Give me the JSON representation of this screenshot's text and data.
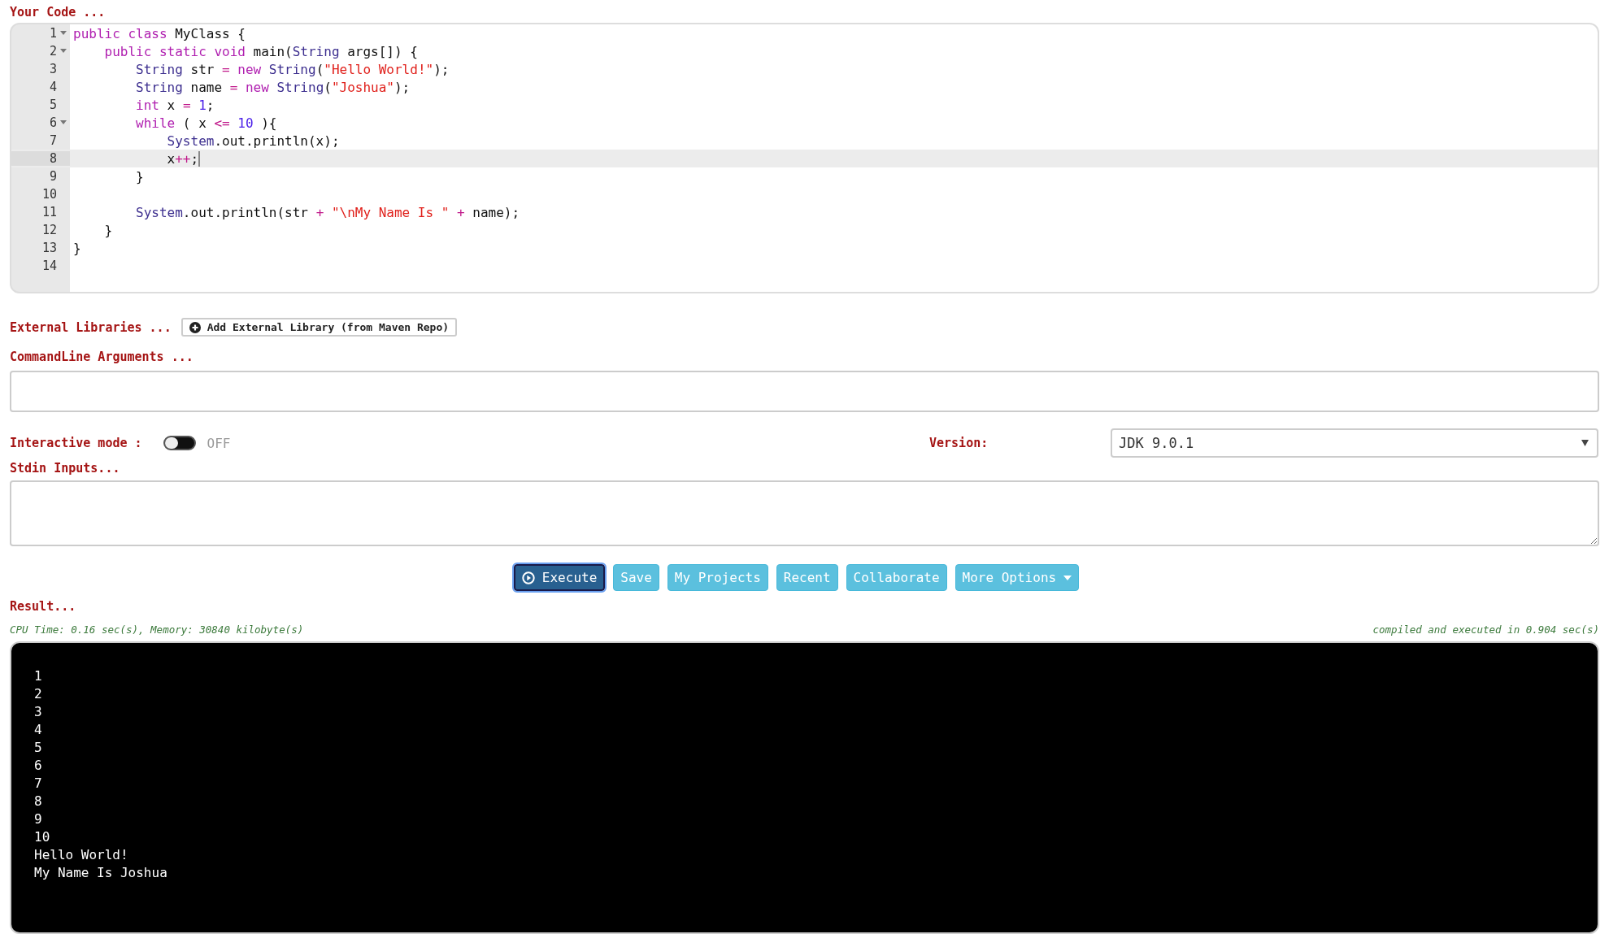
{
  "code_section": {
    "label": "Your Code ...",
    "lines": [
      {
        "number": "1",
        "foldable": true,
        "selected": false,
        "tokens": [
          {
            "kind": "keyword",
            "text": "public class"
          },
          {
            "kind": "plain",
            "text": " MyClass {"
          }
        ]
      },
      {
        "number": "2",
        "foldable": true,
        "selected": false,
        "tokens": [
          {
            "kind": "keyword",
            "text": "    public static void"
          },
          {
            "kind": "plain",
            "text": " main("
          },
          {
            "kind": "type",
            "text": "String"
          },
          {
            "kind": "plain",
            "text": " args[]) {"
          }
        ]
      },
      {
        "number": "3",
        "foldable": false,
        "selected": false,
        "tokens": [
          {
            "kind": "type",
            "text": "        String"
          },
          {
            "kind": "plain",
            "text": " str "
          },
          {
            "kind": "operator",
            "text": "="
          },
          {
            "kind": "keyword",
            "text": " new"
          },
          {
            "kind": "type",
            "text": " String"
          },
          {
            "kind": "plain",
            "text": "("
          },
          {
            "kind": "string",
            "text": "\"Hello World!\""
          },
          {
            "kind": "plain",
            "text": ");"
          }
        ]
      },
      {
        "number": "4",
        "foldable": false,
        "selected": false,
        "tokens": [
          {
            "kind": "type",
            "text": "        String"
          },
          {
            "kind": "plain",
            "text": " name "
          },
          {
            "kind": "operator",
            "text": "="
          },
          {
            "kind": "keyword",
            "text": " new"
          },
          {
            "kind": "type",
            "text": " String"
          },
          {
            "kind": "plain",
            "text": "("
          },
          {
            "kind": "string",
            "text": "\"Joshua\""
          },
          {
            "kind": "plain",
            "text": ");"
          }
        ]
      },
      {
        "number": "5",
        "foldable": false,
        "selected": false,
        "tokens": [
          {
            "kind": "keyword",
            "text": "        int"
          },
          {
            "kind": "plain",
            "text": " x "
          },
          {
            "kind": "operator",
            "text": "="
          },
          {
            "kind": "number",
            "text": " 1"
          },
          {
            "kind": "plain",
            "text": ";"
          }
        ]
      },
      {
        "number": "6",
        "foldable": true,
        "selected": false,
        "tokens": [
          {
            "kind": "keyword",
            "text": "        while"
          },
          {
            "kind": "plain",
            "text": " ( x "
          },
          {
            "kind": "operator",
            "text": "<="
          },
          {
            "kind": "number",
            "text": " 10"
          },
          {
            "kind": "plain",
            "text": " ){"
          }
        ]
      },
      {
        "number": "7",
        "foldable": false,
        "selected": false,
        "tokens": [
          {
            "kind": "type",
            "text": "            System"
          },
          {
            "kind": "plain",
            "text": ".out.println(x);"
          }
        ]
      },
      {
        "number": "8",
        "foldable": false,
        "selected": true,
        "tokens": [
          {
            "kind": "plain",
            "text": "            x"
          },
          {
            "kind": "operator",
            "text": "++"
          },
          {
            "kind": "plain",
            "text": ";"
          }
        ]
      },
      {
        "number": "9",
        "foldable": false,
        "selected": false,
        "tokens": [
          {
            "kind": "plain",
            "text": "        }"
          }
        ]
      },
      {
        "number": "10",
        "foldable": false,
        "selected": false
      },
      {
        "number": "11",
        "foldable": false,
        "selected": false,
        "tokens": [
          {
            "kind": "type",
            "text": "        System"
          },
          {
            "kind": "plain",
            "text": ".out.println(str "
          },
          {
            "kind": "operator",
            "text": "+"
          },
          {
            "kind": "string",
            "text": " \"\\nMy Name Is \""
          },
          {
            "kind": "operator",
            "text": " +"
          },
          {
            "kind": "plain",
            "text": " name);"
          }
        ]
      },
      {
        "number": "12",
        "foldable": false,
        "selected": false,
        "tokens": [
          {
            "kind": "plain",
            "text": "    }"
          }
        ]
      },
      {
        "number": "13",
        "foldable": false,
        "selected": false,
        "tokens": [
          {
            "kind": "plain",
            "text": "}"
          }
        ]
      },
      {
        "number": "14",
        "foldable": false,
        "selected": false
      }
    ]
  },
  "external_libraries": {
    "label": "External Libraries ...",
    "button": "Add External Library (from Maven Repo)"
  },
  "commandline_arguments": {
    "label": "CommandLine Arguments ..."
  },
  "interactive_mode": {
    "label": "Interactive mode :",
    "on": false,
    "state_text": "OFF"
  },
  "version": {
    "label": "Version:",
    "value": "JDK 9.0.1"
  },
  "stdin_inputs": {
    "label": "Stdin Inputs..."
  },
  "buttons": [
    {
      "label": "Execute",
      "kind": "primary",
      "dropdown": false
    },
    {
      "label": "Save",
      "kind": "info",
      "dropdown": false
    },
    {
      "label": "My Projects",
      "kind": "info",
      "dropdown": false
    },
    {
      "label": "Recent",
      "kind": "info",
      "dropdown": false
    },
    {
      "label": "Collaborate",
      "kind": "info",
      "dropdown": false
    },
    {
      "label": "More Options",
      "kind": "info",
      "dropdown": true
    }
  ],
  "result": {
    "label": "Result...",
    "stats": "CPU Time: 0.16 sec(s), Memory: 30840 kilobyte(s)",
    "timing": "compiled and executed in 0.904 sec(s)",
    "output": [
      "1",
      "2",
      "3",
      "4",
      "5",
      "6",
      "7",
      "8",
      "9",
      "10",
      "Hello World!",
      "My Name Is Joshua"
    ]
  }
}
